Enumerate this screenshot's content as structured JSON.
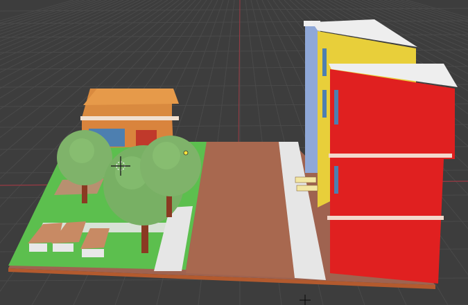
{
  "app": {
    "name": "",
    "view": ""
  },
  "viewport": {
    "background_color": "#3d3d3d",
    "grid_color": "#4a4a4a",
    "axis_x_color": "#b0404a",
    "axis_y_color": "#6b9a3a"
  },
  "scene": {
    "objects": [
      {
        "name": "ground-base",
        "type": "plane"
      },
      {
        "name": "orange-house",
        "type": "building",
        "color": "#d9843d"
      },
      {
        "name": "blue-building",
        "type": "building",
        "color": "#8fa8d8"
      },
      {
        "name": "yellow-building",
        "type": "building",
        "color": "#e8cf3a"
      },
      {
        "name": "red-building",
        "type": "building",
        "color": "#e02020"
      },
      {
        "name": "tree-1",
        "type": "tree"
      },
      {
        "name": "tree-2",
        "type": "tree"
      },
      {
        "name": "tree-3",
        "type": "tree"
      },
      {
        "name": "bench-1",
        "type": "bench"
      },
      {
        "name": "bench-2",
        "type": "bench"
      },
      {
        "name": "bench-3",
        "type": "bench"
      }
    ],
    "colors": {
      "road": "#a8684f",
      "grass": "#5cbf4e",
      "sidewalk": "#e6e6e6",
      "tree_foliage": "#7fb36a",
      "tree_trunk": "#8a3a22",
      "base_edge": "#b35a2e"
    }
  },
  "tools": {
    "cursor_icon": "3d-cursor-icon",
    "light_icon": "light-icon"
  }
}
